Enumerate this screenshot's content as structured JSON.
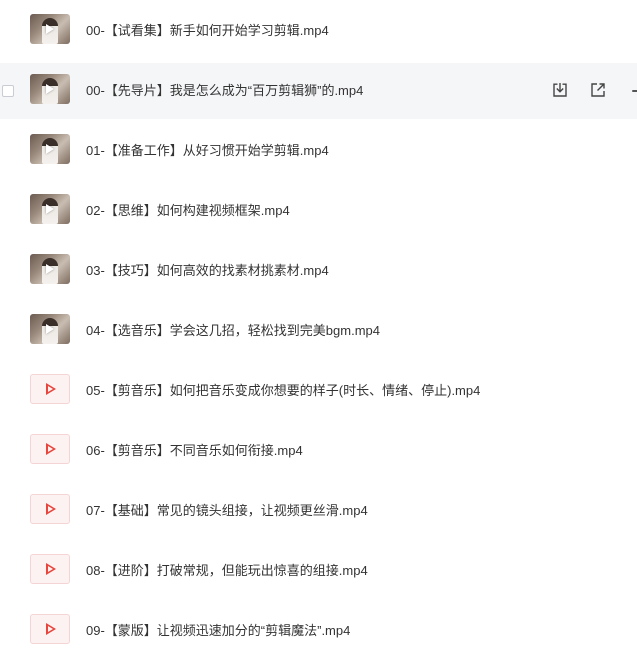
{
  "files": [
    {
      "name": "00-【试看集】新手如何开始学习剪辑.mp4",
      "thumb": "photo"
    },
    {
      "name": "00-【先导片】我是怎么成为“百万剪辑狮”的.mp4",
      "thumb": "photo"
    },
    {
      "name": "01-【准备工作】从好习惯开始学剪辑.mp4",
      "thumb": "photo"
    },
    {
      "name": "02-【思维】如何构建视频框架.mp4",
      "thumb": "photo"
    },
    {
      "name": "03-【技巧】如何高效的找素材挑素材.mp4",
      "thumb": "photo"
    },
    {
      "name": "04-【选音乐】学会这几招，轻松找到完美bgm.mp4",
      "thumb": "photo"
    },
    {
      "name": "05-【剪音乐】如何把音乐变成你想要的样子(时长、情绪、停止).mp4",
      "thumb": "video-icon"
    },
    {
      "name": "06-【剪音乐】不同音乐如何衔接.mp4",
      "thumb": "video-icon"
    },
    {
      "name": "07-【基础】常见的镜头组接，让视频更丝滑.mp4",
      "thumb": "video-icon"
    },
    {
      "name": "08-【进阶】打破常规，但能玩出惊喜的组接.mp4",
      "thumb": "video-icon"
    },
    {
      "name": "09-【蒙版】让视频迅速加分的“剪辑魔法”.mp4",
      "thumb": "video-icon"
    }
  ],
  "hovered_row_actions": [
    "download-icon",
    "share-icon",
    "more-icon"
  ],
  "colors": {
    "hover_bg": "#f5f6f8",
    "text": "#333333",
    "video_icon_red": "#e8453c",
    "video_icon_bg": "#fdf2f2"
  }
}
